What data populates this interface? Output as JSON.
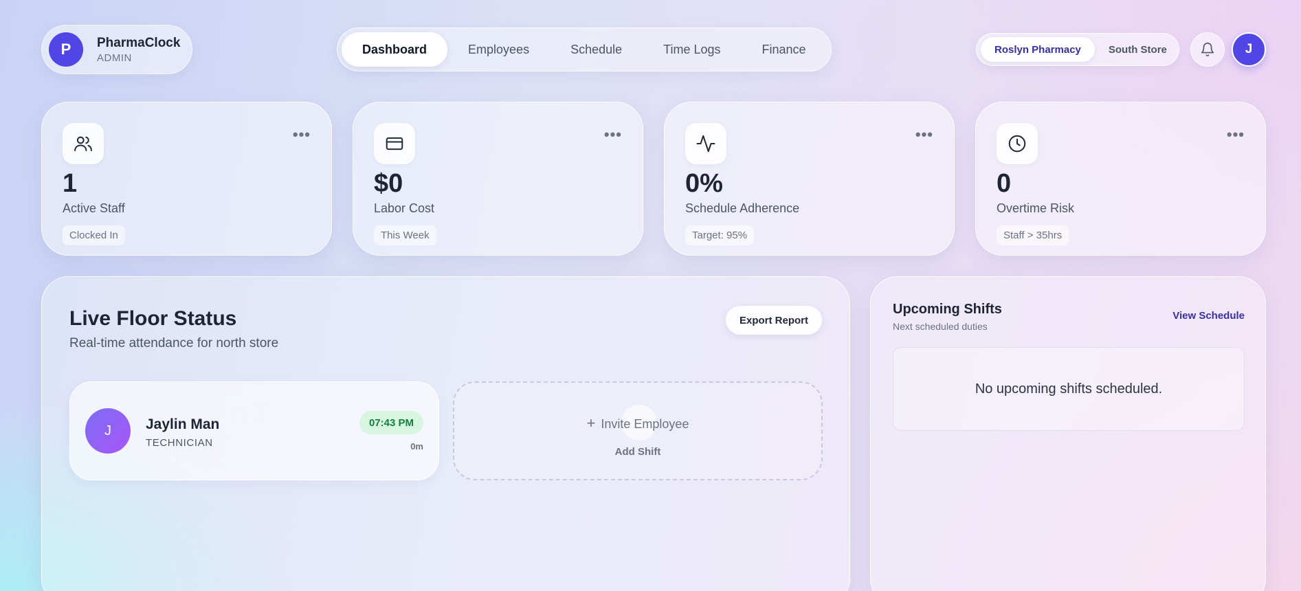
{
  "brand": {
    "logo_letter": "P",
    "name": "PharmaClock",
    "role": "ADMIN",
    "color": "#4f46e5"
  },
  "nav": {
    "items": [
      {
        "label": "Dashboard",
        "active": true
      },
      {
        "label": "Employees",
        "active": false
      },
      {
        "label": "Schedule",
        "active": false
      },
      {
        "label": "Time Logs",
        "active": false
      },
      {
        "label": "Finance",
        "active": false
      }
    ]
  },
  "stores": {
    "items": [
      {
        "label": "Roslyn Pharmacy",
        "active": true
      },
      {
        "label": "South Store",
        "active": false
      }
    ]
  },
  "header": {
    "notification_icon": "bell-icon",
    "user_initial": "J"
  },
  "stats": [
    {
      "icon": "users-icon",
      "value": "1",
      "label": "Active Staff",
      "tag": "Clocked In"
    },
    {
      "icon": "credit-card-icon",
      "value": "$0",
      "label": "Labor Cost",
      "tag": "This Week"
    },
    {
      "icon": "activity-icon",
      "value": "0%",
      "label": "Schedule Adherence",
      "tag": "Target: 95%"
    },
    {
      "icon": "clock-icon",
      "value": "0",
      "label": "Overtime Risk",
      "tag": "Staff > 35hrs"
    }
  ],
  "floor": {
    "title": "Live Floor Status",
    "subtitle": "Real-time attendance for north store",
    "export_label": "Export Report",
    "employees": [
      {
        "initial": "J",
        "name": "Jaylin Man",
        "role": "TECHNICIAN",
        "clock_time": "07:43 PM",
        "duration": "0m"
      }
    ],
    "invite": {
      "label": "Invite Employee",
      "sub_label": "Add Shift"
    }
  },
  "shifts": {
    "title": "Upcoming Shifts",
    "subtitle": "Next scheduled duties",
    "link_label": "View Schedule",
    "empty_message": "No upcoming shifts scheduled."
  },
  "colors": {
    "accent": "#4f46e5",
    "success_bg": "#d8f5e2",
    "success_text": "#15803d",
    "link": "#3730a3"
  }
}
